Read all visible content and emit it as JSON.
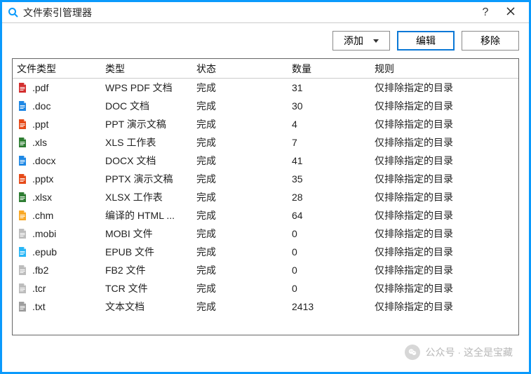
{
  "window": {
    "title": "文件索引管理器"
  },
  "toolbar": {
    "add_label": "添加",
    "edit_label": "编辑",
    "remove_label": "移除"
  },
  "columns": {
    "ext": "文件类型",
    "type": "类型",
    "state": "状态",
    "count": "数量",
    "rule": "规则"
  },
  "rows": [
    {
      "ext": ".pdf",
      "type": "WPS PDF 文档",
      "state": "完成",
      "count": "31",
      "rule": "仅排除指定的目录",
      "icon": "pdf",
      "color": "#d32f2f"
    },
    {
      "ext": ".doc",
      "type": "DOC 文档",
      "state": "完成",
      "count": "30",
      "rule": "仅排除指定的目录",
      "icon": "doc",
      "color": "#1e88e5"
    },
    {
      "ext": ".ppt",
      "type": "PPT 演示文稿",
      "state": "完成",
      "count": "4",
      "rule": "仅排除指定的目录",
      "icon": "ppt",
      "color": "#e64a19"
    },
    {
      "ext": ".xls",
      "type": "XLS 工作表",
      "state": "完成",
      "count": "7",
      "rule": "仅排除指定的目录",
      "icon": "xls",
      "color": "#2e7d32"
    },
    {
      "ext": ".docx",
      "type": "DOCX 文档",
      "state": "完成",
      "count": "41",
      "rule": "仅排除指定的目录",
      "icon": "doc",
      "color": "#1e88e5"
    },
    {
      "ext": ".pptx",
      "type": "PPTX 演示文稿",
      "state": "完成",
      "count": "35",
      "rule": "仅排除指定的目录",
      "icon": "ppt",
      "color": "#e64a19"
    },
    {
      "ext": ".xlsx",
      "type": "XLSX 工作表",
      "state": "完成",
      "count": "28",
      "rule": "仅排除指定的目录",
      "icon": "xls",
      "color": "#2e7d32"
    },
    {
      "ext": ".chm",
      "type": "编译的 HTML ...",
      "state": "完成",
      "count": "64",
      "rule": "仅排除指定的目录",
      "icon": "chm",
      "color": "#f9a825"
    },
    {
      "ext": ".mobi",
      "type": "MOBI 文件",
      "state": "完成",
      "count": "0",
      "rule": "仅排除指定的目录",
      "icon": "file",
      "color": "#bdbdbd"
    },
    {
      "ext": ".epub",
      "type": "EPUB 文件",
      "state": "完成",
      "count": "0",
      "rule": "仅排除指定的目录",
      "icon": "epub",
      "color": "#29b6f6"
    },
    {
      "ext": ".fb2",
      "type": "FB2 文件",
      "state": "完成",
      "count": "0",
      "rule": "仅排除指定的目录",
      "icon": "file",
      "color": "#bdbdbd"
    },
    {
      "ext": ".tcr",
      "type": "TCR 文件",
      "state": "完成",
      "count": "0",
      "rule": "仅排除指定的目录",
      "icon": "file",
      "color": "#bdbdbd"
    },
    {
      "ext": ".txt",
      "type": "文本文档",
      "state": "完成",
      "count": "2413",
      "rule": "仅排除指定的目录",
      "icon": "txt",
      "color": "#9e9e9e"
    }
  ],
  "watermark": {
    "text": "公众号 · 这全是宝藏"
  }
}
